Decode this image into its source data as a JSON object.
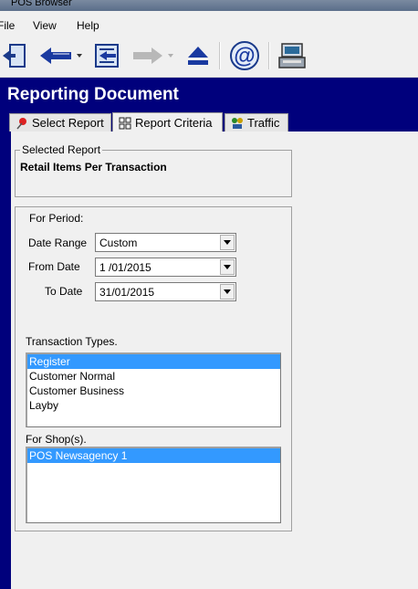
{
  "window": {
    "title": "POS Browser"
  },
  "menu": [
    {
      "label": "File",
      "accel": "F"
    },
    {
      "label": "View",
      "accel": "V"
    },
    {
      "label": "Help",
      "accel": "H"
    }
  ],
  "header": {
    "title": "Reporting Document"
  },
  "tabs": [
    {
      "label": "Select Report",
      "icon": "pin-icon"
    },
    {
      "label": "Report Criteria",
      "icon": "criteria-icon"
    },
    {
      "label": "Traffic",
      "icon": "traffic-icon"
    }
  ],
  "selected_report": {
    "legend": "Selected Report",
    "name": "Retail Items Per Transaction"
  },
  "period": {
    "legend": "For Period:",
    "date_range_label": "Date Range",
    "date_range_value": "Custom",
    "from_label": "From Date",
    "from_value": "1 /01/2015",
    "to_label": "To Date",
    "to_value": "31/01/2015"
  },
  "transaction_types": {
    "label": "Transaction Types.",
    "items": [
      "Register",
      "Customer Normal",
      "Customer Business",
      "Layby"
    ],
    "selected": "Register"
  },
  "shops": {
    "label": "For Shop(s).",
    "items": [
      "POS Newsagency 1"
    ],
    "selected": "POS Newsagency 1"
  },
  "colors": {
    "header_bg": "#00007c",
    "selection": "#3399ff"
  }
}
